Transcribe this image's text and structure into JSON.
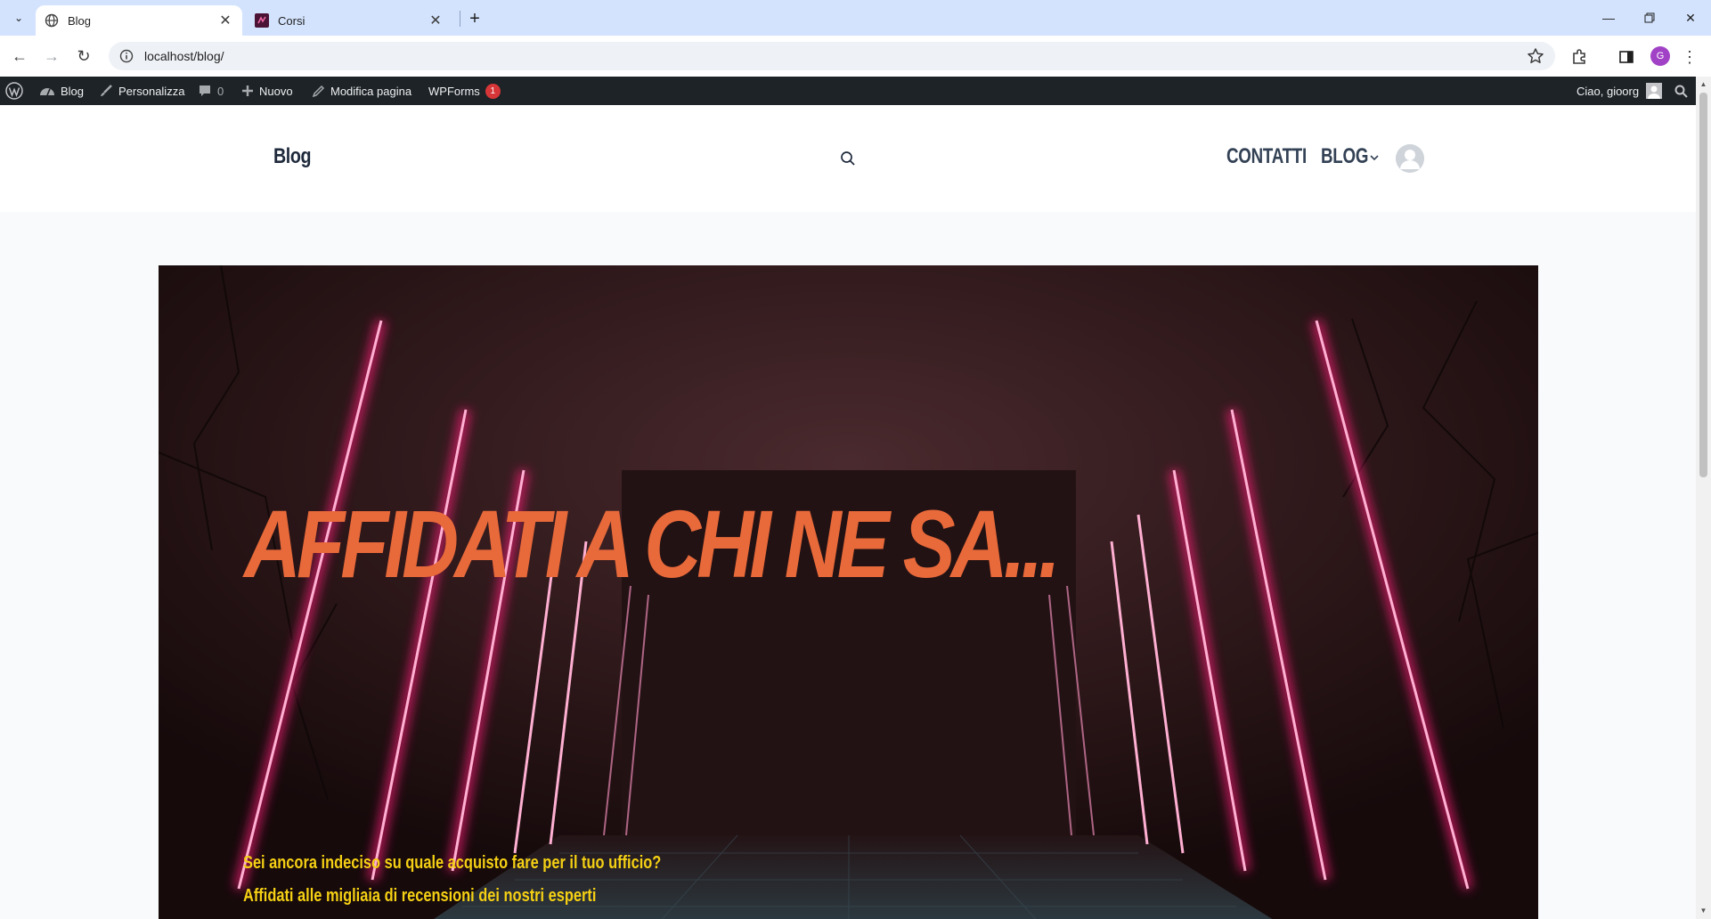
{
  "browser": {
    "tabs": [
      {
        "title": "Blog",
        "active": true
      },
      {
        "title": "Corsi",
        "active": false
      }
    ],
    "url": "localhost/blog/",
    "profile_initial": "G"
  },
  "adminbar": {
    "site": "Blog",
    "customize": "Personalizza",
    "comments_count": "0",
    "new": "Nuovo",
    "edit_page": "Modifica pagina",
    "wpforms": "WPForms",
    "wpforms_badge": "1",
    "greeting": "Ciao, gioorg"
  },
  "site": {
    "title": "Blog",
    "menu": [
      {
        "label": "CONTATTI"
      },
      {
        "label": "BLOG"
      }
    ]
  },
  "hero": {
    "title": "AFFIDATI A CHI NE SA...",
    "line1": "Sei ancora indeciso su quale acquisto fare per il tuo ufficio?",
    "line2": "Affidati alle migliaia di recensioni dei nostri esperti"
  },
  "colors": {
    "hero_title": "#e8693a",
    "hero_text": "#f5d014",
    "neon": "#ff2d8a",
    "adminbar": "#1d2327"
  }
}
